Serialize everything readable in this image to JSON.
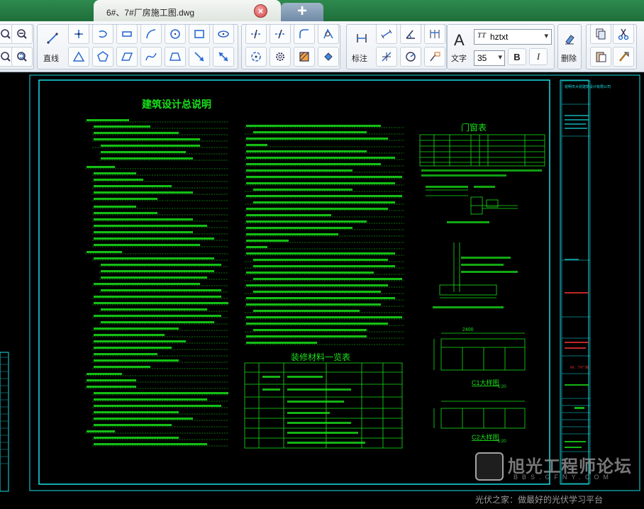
{
  "tab": {
    "title": "6#、7#厂房施工图.dwg",
    "close_glyph": "×",
    "new_glyph": "+"
  },
  "toolbar": {
    "line_label": "直线",
    "dim_label": "标注",
    "text_label": "文字",
    "delete_label": "删除",
    "text_big": "A",
    "font_name": "hztxt",
    "font_size": "35",
    "bold": "B",
    "italic": "I"
  },
  "drawing": {
    "title": "建筑设计总说明",
    "door_table_title": "门窗表",
    "material_table_title": "装修材料一览表",
    "detail_c1": "C1大样图",
    "detail_c2": "C2大样图",
    "scale": "1:20",
    "title_block_company": "昆明市大昆建筑设计有限公司",
    "title_block_project": "6#、7#厂房",
    "dim_value": "2400"
  },
  "watermark": {
    "brand": "旭光工程师论坛",
    "site": "BBS.GFNY.COM",
    "slogan": "光伏之家：做最好的光伏学习平台"
  },
  "colors": {
    "cad_green": "#19e019",
    "cad_cyan": "#19e0e6",
    "tab_bar": "#1f6e3a",
    "canvas": "#000000"
  }
}
